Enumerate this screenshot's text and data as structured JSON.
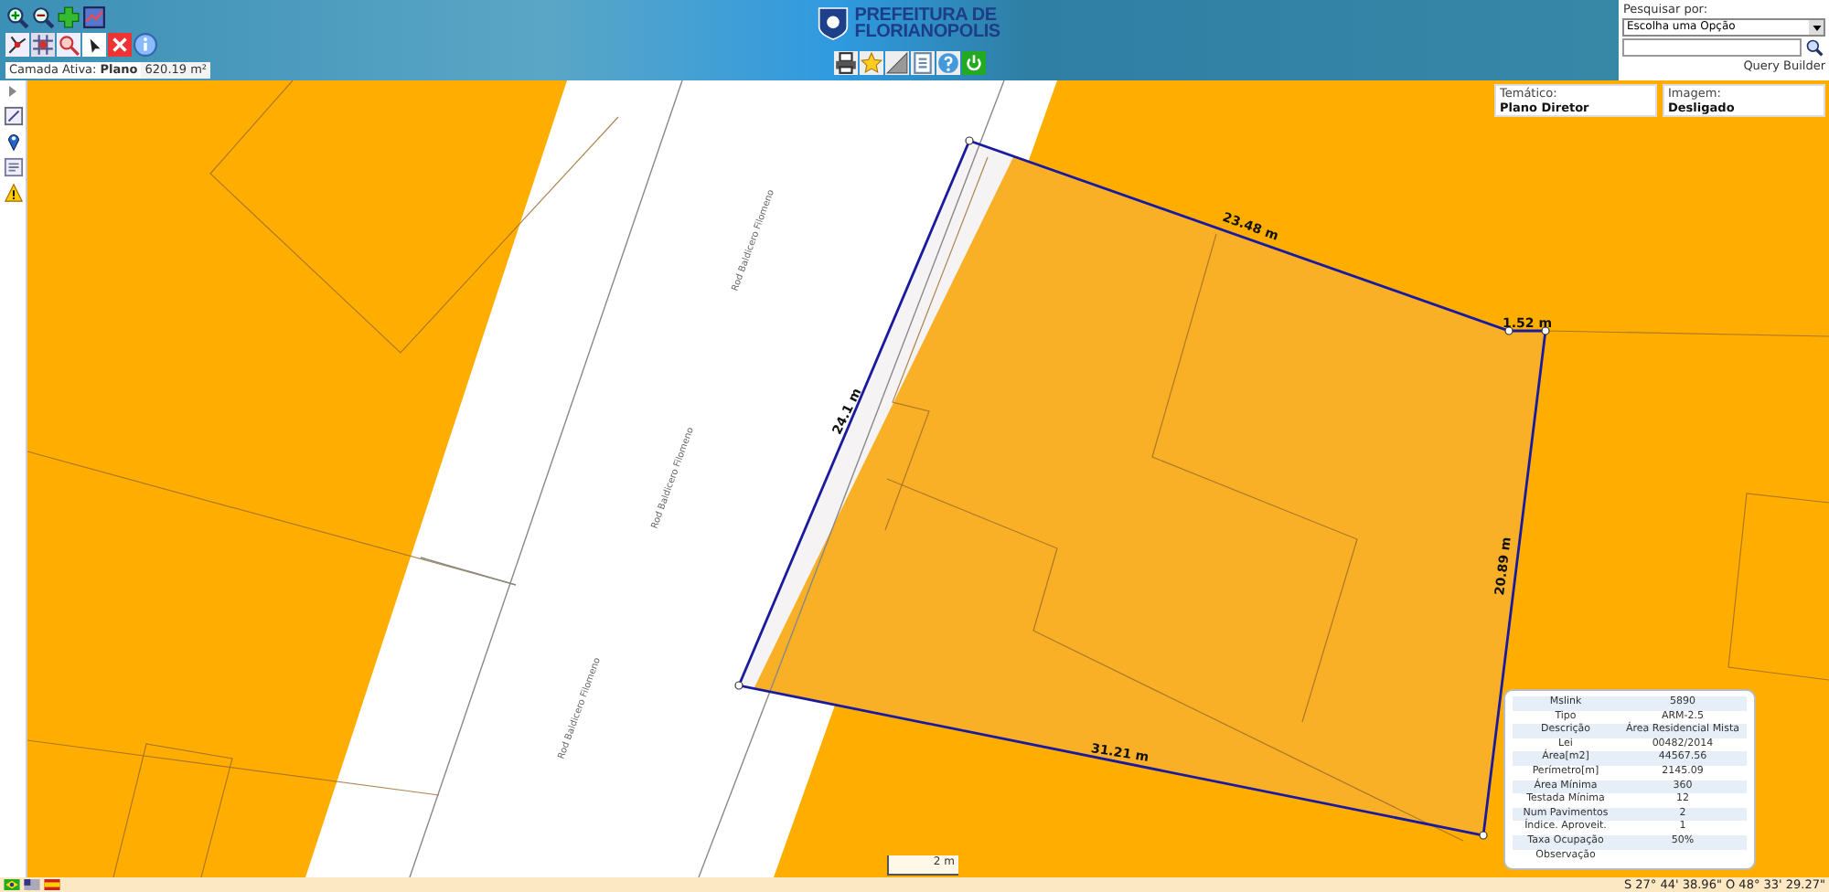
{
  "header": {
    "title_line_1": "PREFEITURA DE",
    "title_line_2": "FLORIANOPOLIS",
    "active_layer": {
      "label": "Camada Ativa:",
      "value": "Plano",
      "measurement": "620.19 m²"
    }
  },
  "search": {
    "label": "Pesquisar por:",
    "select_value": "Escolha uma Opção",
    "query_builder": "Query Builder"
  },
  "map_panels": [
    {
      "label": "Temático:",
      "value": "Plano Diretor"
    },
    {
      "label": "Imagem:",
      "value": "Desligado"
    }
  ],
  "map": {
    "road_labels": [
      "Rod Baldicero Filomeno",
      "Rod Baldicero Filomeno",
      "Rod Baldicero Filomeno"
    ],
    "measurements": [
      "24.1 m",
      "23.48 m",
      "1.52 m",
      "20.89 m",
      "31.21 m"
    ]
  },
  "info": {
    "rows": [
      {
        "label": "Mslink",
        "value": "5890"
      },
      {
        "label": "Tipo",
        "value": "ARM-2.5"
      },
      {
        "label": "Descrição",
        "value": "Área Residencial Mista"
      },
      {
        "label": "Lei",
        "value": "00482/2014"
      },
      {
        "label": "Área[m2]",
        "value": "44567.56"
      },
      {
        "label": "Perímetro[m]",
        "value": "2145.09"
      },
      {
        "label": "Área Mínima",
        "value": "360"
      },
      {
        "label": "Testada Mínima",
        "value": "12"
      },
      {
        "label": "Num Pavimentos",
        "value": "2"
      },
      {
        "label": "Índice. Aproveit.",
        "value": "1"
      },
      {
        "label": "Taxa Ocupação",
        "value": "50%"
      },
      {
        "label": "Observação"
      }
    ]
  },
  "scale": {
    "label": "2 m"
  },
  "status_bar": {
    "coordinates": "S 27° 44' 38.96\" O 48° 33' 29.27\""
  }
}
